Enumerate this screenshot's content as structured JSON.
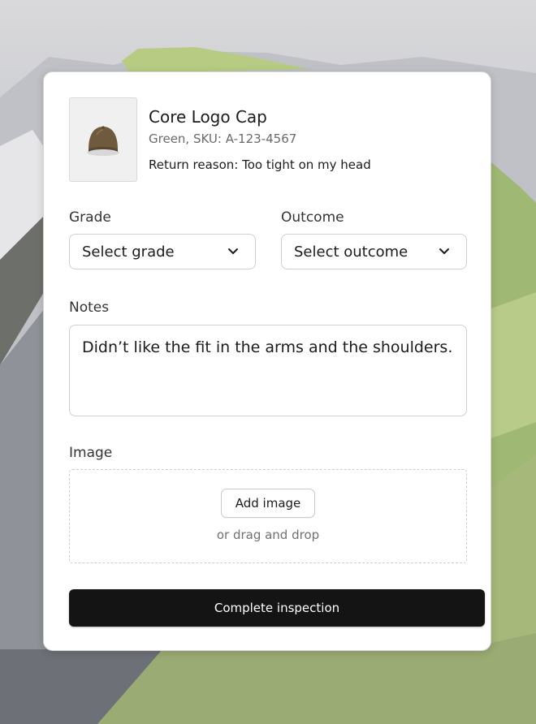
{
  "product": {
    "title": "Core Logo Cap",
    "subtitle": "Green, SKU: A-123-4567",
    "return_reason": "Return reason: Too tight on my head"
  },
  "form": {
    "grade_label": "Grade",
    "grade_value": "Select grade",
    "outcome_label": "Outcome",
    "outcome_value": "Select outcome",
    "notes_label": "Notes",
    "notes_value": "Didn’t like the fit in the arms and the shoulders.",
    "image_label": "Image",
    "add_image_label": "Add image",
    "drag_text": "or drag and drop"
  },
  "actions": {
    "complete_label": "Complete inspection"
  },
  "colors": {
    "primary_button": "#141414",
    "card_bg": "#ffffff",
    "border": "#cfcfcf"
  }
}
